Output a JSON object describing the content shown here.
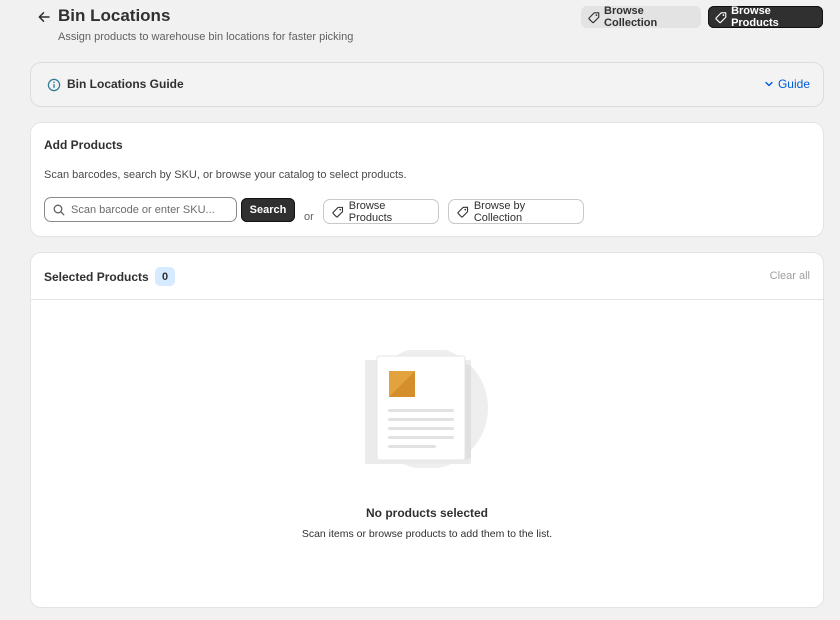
{
  "header": {
    "title": "Bin Locations",
    "subtitle": "Assign products to warehouse bin locations for faster picking",
    "browse_collection_label": "Browse Collection",
    "browse_products_label": "Browse Products"
  },
  "guide": {
    "title": "Bin Locations Guide",
    "toggle_label": "Guide"
  },
  "add_products": {
    "title": "Add Products",
    "description": "Scan barcodes, search by SKU, or browse your catalog to select products.",
    "search_placeholder": "Scan barcode or enter SKU...",
    "search_value": "",
    "search_button": "Search",
    "or_text": "or",
    "browse_products_label": "Browse Products",
    "browse_by_collection_label": "Browse by Collection"
  },
  "selected_products": {
    "title": "Selected Products",
    "count": "0",
    "clear_all_label": "Clear all",
    "empty_title": "No products selected",
    "empty_description": "Scan items or browse products to add them to the list."
  },
  "colors": {
    "primary_button": "#303030",
    "link": "#005bd3",
    "count_badge": "#d6ebff",
    "page_bg": "#f1f1f1"
  },
  "icons": {
    "back": "arrow-left-icon",
    "tag": "tag-icon",
    "info": "info-icon",
    "chevron": "chevron-down-icon",
    "search": "search-icon"
  }
}
